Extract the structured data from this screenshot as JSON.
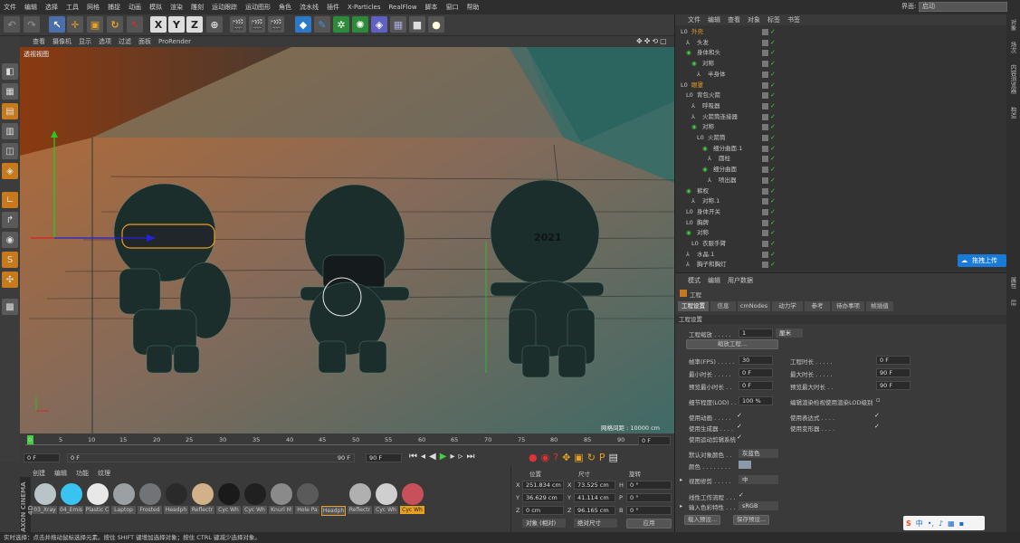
{
  "menubar": {
    "items": [
      "文件",
      "编辑",
      "选择",
      "工具",
      "网格",
      "捕捉",
      "动画",
      "模拟",
      "渲染",
      "雕刻",
      "运动跟踪",
      "运动图形",
      "角色",
      "流水线",
      "插件",
      "X-Particles",
      "RealFlow",
      "脚本",
      "窗口",
      "帮助"
    ],
    "layout_label": "界面:",
    "layout_value": "启动"
  },
  "toolbar": {
    "xyz": [
      "X",
      "Y",
      "Z"
    ]
  },
  "viewport": {
    "menu": [
      "查看",
      "摄像机",
      "显示",
      "选项",
      "过滤",
      "面板",
      "ProRender"
    ],
    "name": "透视视图",
    "grid_info": "网格间距 : 10000 cm",
    "text_2021": "2021"
  },
  "timeline": {
    "ticks": [
      "0",
      "5",
      "10",
      "15",
      "20",
      "25",
      "30",
      "35",
      "40",
      "45",
      "50",
      "55",
      "60",
      "65",
      "70",
      "75",
      "80",
      "85",
      "90"
    ],
    "end_frame": "0 F"
  },
  "transport": {
    "start": "0 F",
    "current": "0 F",
    "range_end": "90 F",
    "end": "90 F"
  },
  "materials": {
    "menu": [
      "创建",
      "编辑",
      "功能",
      "纹理"
    ],
    "items": [
      {
        "name": "03_Xray",
        "color": "#b8c4c8"
      },
      {
        "name": "04_Emis",
        "color": "#39c3f0"
      },
      {
        "name": "Plastic C",
        "color": "#e8e8e8"
      },
      {
        "name": "Laptop",
        "color": "#9aa0a4"
      },
      {
        "name": "Frosted",
        "color": "#707476"
      },
      {
        "name": "Headph",
        "color": "#2a2a2a"
      },
      {
        "name": "Reflectr",
        "color": "#d2b08a"
      },
      {
        "name": "Cyc Wh",
        "color": "#1a1a1a"
      },
      {
        "name": "Cyc Wh",
        "color": "#202020"
      },
      {
        "name": "Knurl M",
        "color": "#8a8a8a"
      },
      {
        "name": "Hole Pa",
        "color": "#5a5a5a"
      },
      {
        "name": "Headph",
        "color": "#3a3a3a"
      },
      {
        "name": "Reflectr",
        "color": "#b0b0b0"
      },
      {
        "name": "Cyc Wh",
        "color": "#cfcfcf"
      },
      {
        "name": "Cyc Wh",
        "color": "#c8505a"
      }
    ]
  },
  "coords": {
    "headers": [
      "位置",
      "尺寸",
      "旋转"
    ],
    "rows": [
      {
        "axis": "X",
        "pos": "251.834 cm",
        "size_axis": "X",
        "size": "73.525 cm",
        "rot_axis": "H",
        "rot": "0 °"
      },
      {
        "axis": "Y",
        "pos": "36.629 cm",
        "size_axis": "Y",
        "size": "41.114 cm",
        "rot_axis": "P",
        "rot": "0 °"
      },
      {
        "axis": "Z",
        "pos": "0 cm",
        "size_axis": "Z",
        "size": "96.165 cm",
        "rot_axis": "B",
        "rot": "0 °"
      }
    ],
    "mode": "对象 (相对)",
    "size_mode": "绝对尺寸",
    "apply": "应用"
  },
  "objects": {
    "menu": [
      "文件",
      "编辑",
      "查看",
      "对象",
      "标签",
      "书签"
    ],
    "rows": [
      {
        "name": "外壳",
        "indent": 0,
        "type": "L0",
        "orange": true
      },
      {
        "name": "头发",
        "indent": 1,
        "type": "null"
      },
      {
        "name": "身体和头",
        "indent": 1,
        "type": "sym"
      },
      {
        "name": "对称",
        "indent": 2,
        "type": "sym"
      },
      {
        "name": "半身体",
        "indent": 3,
        "type": "null"
      },
      {
        "name": "眼罩",
        "indent": 0,
        "type": "L0",
        "orange": true
      },
      {
        "name": "背包火箭",
        "indent": 1,
        "type": "L0"
      },
      {
        "name": "呼吸器",
        "indent": 2,
        "type": "null"
      },
      {
        "name": "火箭筒连接器",
        "indent": 2,
        "type": "null"
      },
      {
        "name": "对称",
        "indent": 2,
        "type": "sym"
      },
      {
        "name": "火箭筒",
        "indent": 3,
        "type": "L0"
      },
      {
        "name": "细分曲面.1",
        "indent": 4,
        "type": "sym"
      },
      {
        "name": "圆柱",
        "indent": 5,
        "type": "null"
      },
      {
        "name": "细分曲面",
        "indent": 4,
        "type": "sym"
      },
      {
        "name": "喷出器",
        "indent": 5,
        "type": "null"
      },
      {
        "name": "裤权",
        "indent": 1,
        "type": "sym"
      },
      {
        "name": "对称.1",
        "indent": 2,
        "type": "null"
      },
      {
        "name": "身体开关",
        "indent": 1,
        "type": "L0"
      },
      {
        "name": "胸牌",
        "indent": 1,
        "type": "L0"
      },
      {
        "name": "对称",
        "indent": 1,
        "type": "sym"
      },
      {
        "name": "衣服手臂",
        "indent": 2,
        "type": "L0"
      },
      {
        "name": "水晶.1",
        "indent": 1,
        "type": "null"
      },
      {
        "name": "胸子和胸灯",
        "indent": 1,
        "type": "null"
      }
    ],
    "upload_button": "拖拽上传"
  },
  "attributes": {
    "menu": [
      "模式",
      "编辑",
      "用户数据"
    ],
    "title": "工程",
    "tabs": [
      "工程设置",
      "信息",
      "cmNodes",
      "动力学",
      "参考",
      "待办事项",
      "帧插值"
    ],
    "section": "工程设置",
    "scale_label": "工程缩放 . . . . .",
    "scale_value": "1",
    "scale_unit": "厘米",
    "scale_button": "缩放工程...",
    "fields_left": [
      {
        "label": "帧率(FPS) . . . . .",
        "value": "30"
      },
      {
        "label": "最小时长 . . . . .",
        "value": "0 F"
      },
      {
        "label": "预览最小时长 . .",
        "value": "0 F"
      }
    ],
    "fields_right": [
      {
        "label": "工程时长 . . . . .",
        "value": "0 F"
      },
      {
        "label": "最大时长 . . . . .",
        "value": "90 F"
      },
      {
        "label": "预览最大时长 . .",
        "value": "90 F"
      }
    ],
    "lod_label": "细节程度(LOD) . .",
    "lod_value": "100 %",
    "lod_render_label": "编辑渲染检视使用渲染LOD级别",
    "checks_left": [
      "使用动画 . . . . .",
      "使用生成器 . . . .",
      "使用运动剪辑系统"
    ],
    "checks_right": [
      "使用表达式 . . . .",
      "使用变形器 . . . ."
    ],
    "default_color_label": "默认对象颜色 . .",
    "default_color_value": "灰蓝色",
    "color_label": "颜色 . . . . . . . .",
    "view_clip_label": "视图修剪 . . . . .",
    "view_clip_value": "中",
    "linear_label": "线性工作流程 . . .",
    "input_color_label": "输入色彩特性 . . .",
    "input_color_value": "sRGB",
    "load_preset": "载入预设...",
    "save_preset": "保存预设..."
  },
  "status": {
    "text": "实时选择：点击并拖动鼠标选择元素。按住 SHIFT 键增加选择对象；按住 CTRL 键减少选择对象。"
  },
  "ime": {
    "label": "中"
  },
  "rightstrip": [
    "对象",
    "场次",
    "内容浏览器",
    "构造",
    "属性",
    "层"
  ]
}
